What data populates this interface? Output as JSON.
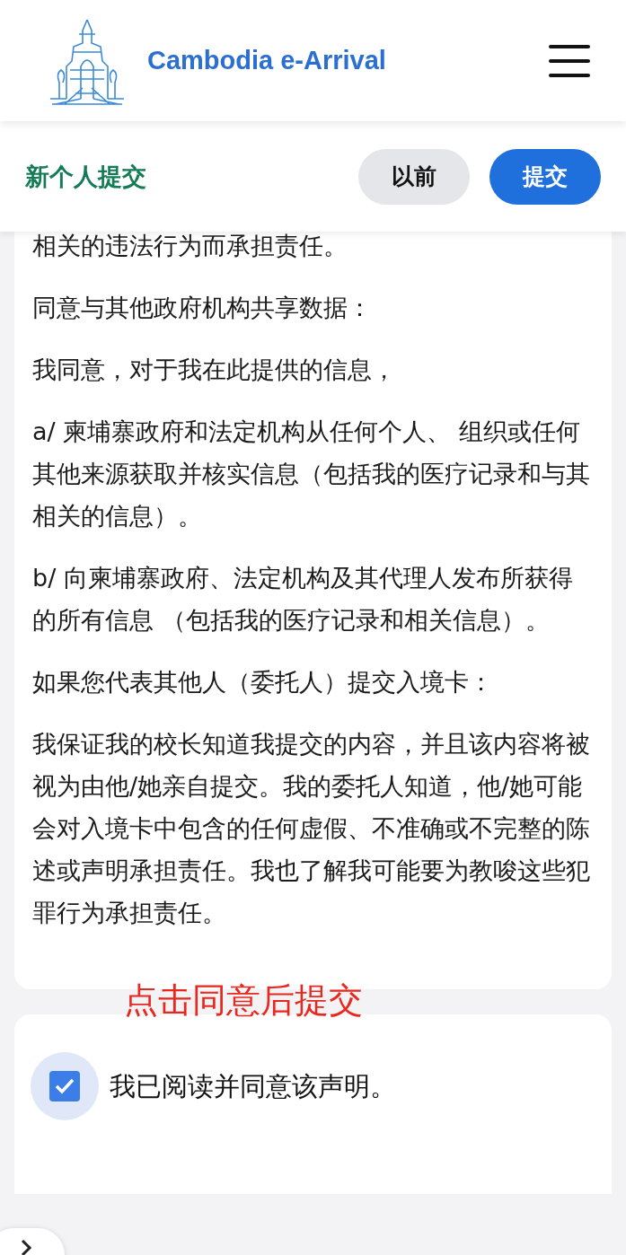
{
  "header": {
    "title": "Cambodia e-Arrival"
  },
  "toolbar": {
    "title": "新个人提交",
    "buttons": [
      {
        "label": "以前",
        "kind": "secondary"
      },
      {
        "label": "提交",
        "kind": "primary"
      }
    ]
  },
  "declaration": {
    "paragraphs": [
      "相关的违法行为而承担责任。",
      "同意与其他政府机构共享数据：",
      "我同意，对于我在此提供的信息，",
      "a/ 柬埔寨政府和法定机构从任何个人、 组织或任何其他来源获取并核实信息（包括我的医疗记录和与其相关的信息）。",
      "b/ 向柬埔寨政府、法定机构及其代理人发布所获得的所有信息 （包括我的医疗记录和相关信息）。",
      "如果您代表其他人（委托人）提交入境卡：",
      "我保证我的校长知道我提交的内容，并且该内容将被视为由他/她亲自提交。我的委托人知道，他/她可能会对入境卡中包含的任何虚假、不准确或不完整的陈述或声明承担责任。我也了解我可能要为教唆这些犯罪行为承担责任。"
    ]
  },
  "annotation": "点击同意后提交",
  "agreement": {
    "label": "我已阅读并同意该声明。",
    "checked": true
  }
}
